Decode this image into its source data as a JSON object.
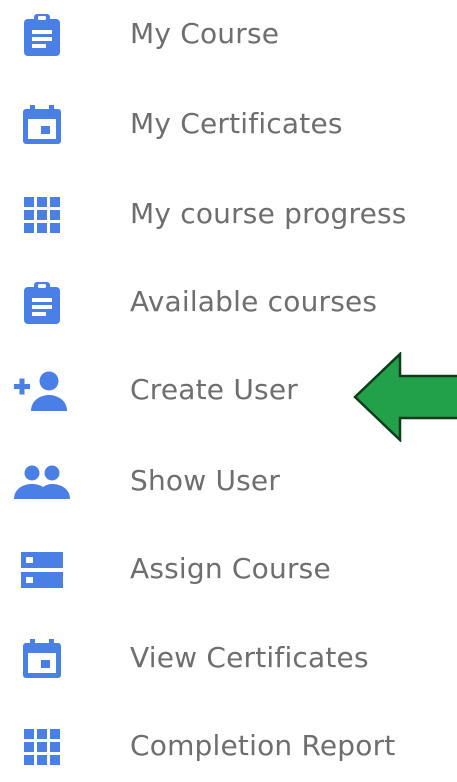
{
  "menu": {
    "items": [
      {
        "label": "My Course",
        "icon": "clipboard-icon"
      },
      {
        "label": "My Certificates",
        "icon": "calendar-icon"
      },
      {
        "label": "My course progress",
        "icon": "grid-icon"
      },
      {
        "label": "Available courses",
        "icon": "clipboard-icon"
      },
      {
        "label": "Create User",
        "icon": "person-add-icon"
      },
      {
        "label": "Show User",
        "icon": "people-icon"
      },
      {
        "label": "Assign Course",
        "icon": "storage-icon"
      },
      {
        "label": "View Certificates",
        "icon": "calendar-icon"
      },
      {
        "label": "Completion Report",
        "icon": "grid-icon"
      }
    ]
  },
  "colors": {
    "icon": "#4a7fe6",
    "label": "#6e6e6e",
    "arrow_fill": "#22a14a",
    "arrow_stroke": "#0b3d1a"
  }
}
